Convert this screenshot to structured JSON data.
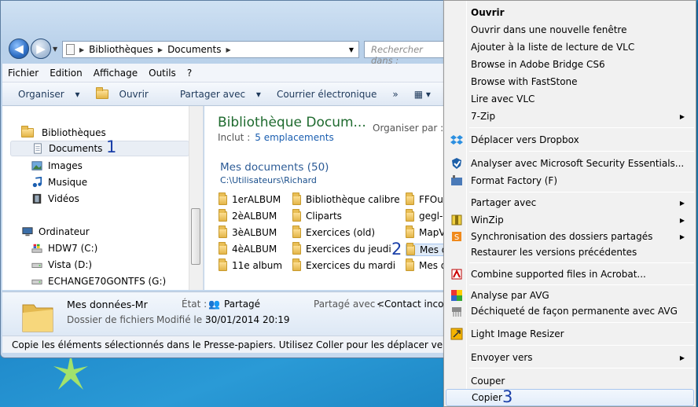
{
  "address": {
    "crumbs": [
      "Bibliothèques",
      "Documents"
    ]
  },
  "search": {
    "placeholder": "Rechercher dans :"
  },
  "menubar": [
    "Fichier",
    "Edition",
    "Affichage",
    "Outils",
    "?"
  ],
  "toolbar": {
    "organize": "Organiser",
    "open": "Ouvrir",
    "share": "Partager avec",
    "email": "Courrier électronique",
    "more": "»"
  },
  "sidebar": {
    "libraries": "Bibliothèques",
    "items": [
      "Documents",
      "Images",
      "Musique",
      "Vidéos"
    ],
    "computer": "Ordinateur",
    "drives": [
      "HDW7 (C:)",
      "Vista (D:)",
      "ECHANGE70GONTFS (G:)"
    ]
  },
  "main": {
    "title": "Bibliothèque Docum...",
    "organize_by": "Organiser par :",
    "include_label": "Inclut :",
    "include_link": "5 emplacements",
    "group_title": "Mes documents (50)",
    "path": "C:\\Utilisateurs\\Richard",
    "folders": [
      [
        "1erALBUM",
        "2èALBUM",
        "3èALBUM",
        "4èALBUM",
        "11e album"
      ],
      [
        "Bibliothèque calibre",
        "Cliparts",
        "Exercices (old)",
        "Exercices du jeudi",
        "Exercices du mardi"
      ],
      [
        "FFOut",
        "gegl-0",
        "MapV",
        "Mes d",
        "Mes d"
      ]
    ]
  },
  "markers": {
    "one": "1",
    "two": "2",
    "three": "3"
  },
  "details": {
    "name": "Mes données-Mr",
    "type": "Dossier de fichiers",
    "state_label": "État :",
    "state_value": "Partagé",
    "modified_label": "Modifié le :",
    "modified_value": "30/01/2014 20:19",
    "shared_label": "Partagé avec :",
    "shared_value": "<Contact incon"
  },
  "status": "Copie les éléments sélectionnés dans le Presse-papiers. Utilisez Coller pour les déplacer vers le nouvel",
  "context_menu": [
    {
      "label": "Ouvrir",
      "bold": true
    },
    {
      "label": "Ouvrir dans une nouvelle fenêtre"
    },
    {
      "label": "Ajouter à la liste de lecture de VLC"
    },
    {
      "label": "Browse in Adobe Bridge CS6"
    },
    {
      "label": "Browse with FastStone"
    },
    {
      "label": "Lire avec VLC"
    },
    {
      "label": "7-Zip",
      "submenu": true
    },
    {
      "label": "Déplacer vers Dropbox",
      "icon": "dropbox-icon"
    },
    {
      "label": "Analyser avec Microsoft Security Essentials...",
      "icon": "security-essentials-icon"
    },
    {
      "label": "Format Factory (F)",
      "icon": "format-factory-icon"
    },
    {
      "label": "Partager avec",
      "submenu": true
    },
    {
      "label": "WinZip",
      "submenu": true,
      "icon": "winzip-icon"
    },
    {
      "label": "Synchronisation des dossiers partagés",
      "submenu": true,
      "icon": "sync-icon"
    },
    {
      "label": "Restaurer les versions précédentes"
    },
    {
      "label": "Combine supported files in Acrobat...",
      "icon": "acrobat-icon"
    },
    {
      "label": "Analyse par AVG",
      "icon": "avg-icon"
    },
    {
      "label": "Déchiqueté de façon permanente avec AVG",
      "icon": "shredder-icon"
    },
    {
      "label": "Light Image Resizer",
      "icon": "image-resizer-icon"
    },
    {
      "label": "Envoyer vers",
      "submenu": true
    },
    {
      "label": "Couper"
    },
    {
      "label": "Copier",
      "highlighted": true
    }
  ],
  "colors": {
    "accent": "#1a3fa8",
    "library_title": "#1e6a2e",
    "link": "#1a5eb0"
  }
}
